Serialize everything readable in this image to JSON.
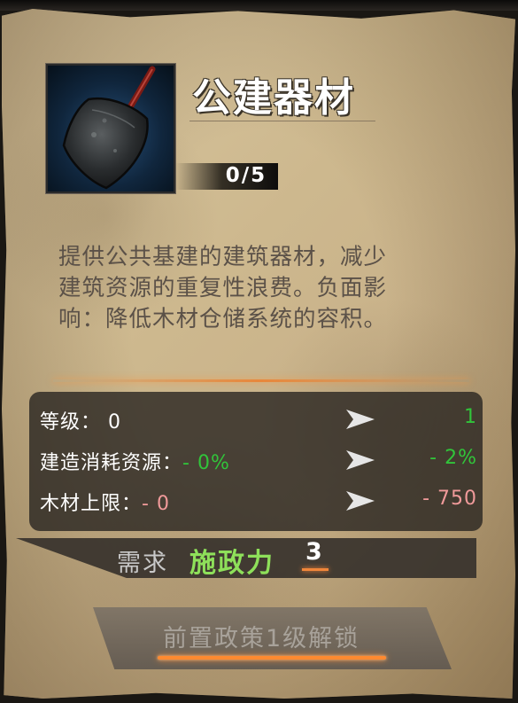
{
  "item": {
    "name": "公建器材",
    "count": "0/5",
    "icon": "shovel-icon",
    "description_lines": [
      "提供公共基建的建筑器材，减少",
      "建筑资源的重复性浪费。负面影",
      "响：降低木材仓储系统的容积。"
    ]
  },
  "stats": [
    {
      "label": "等级：",
      "current": "0",
      "next": "1",
      "current_color": "#ffffff",
      "next_color": "#31c43a"
    },
    {
      "label": "建造消耗资源：",
      "current": "- 0%",
      "next": "- 2%",
      "current_color": "#31c43a",
      "next_color": "#31c43a"
    },
    {
      "label": "木材上限：",
      "current": "- 0",
      "next": "- 750",
      "current_color": "#f09a9a",
      "next_color": "#f09a9a"
    }
  ],
  "requirement": {
    "label": "需求",
    "currency": "施政力",
    "amount": "3"
  },
  "unlock": {
    "label": "前置政策1级解锁"
  },
  "colors": {
    "accent_glow": "#f0863a",
    "positive": "#31c43a",
    "negative": "#f09a9a",
    "currency": "#8ee05a"
  }
}
